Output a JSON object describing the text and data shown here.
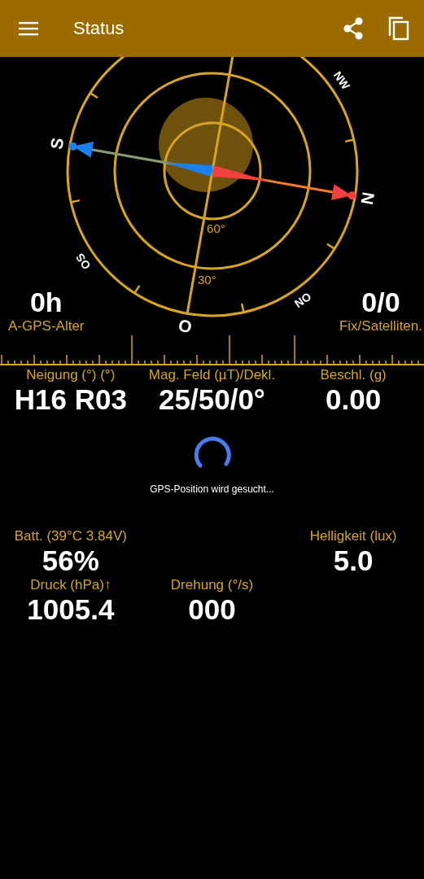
{
  "app_bar": {
    "title": "Status"
  },
  "compass": {
    "directions": [
      {
        "label": "N"
      },
      {
        "label": "NW"
      },
      {
        "label": "S"
      },
      {
        "label": "OS"
      },
      {
        "label": "O"
      },
      {
        "label": "ON"
      }
    ],
    "elevations": [
      "60°",
      "30°"
    ]
  },
  "corner_readouts": [
    {
      "value": "0h",
      "label": "A-GPS-Alter"
    },
    {
      "value": "0/0",
      "label": "Fix/Satelliten."
    }
  ],
  "sensor_row": [
    {
      "label": "Neigung (°) (°)",
      "value": "H16 R03"
    },
    {
      "label": "Mag. Feld (µT)/Dekl.",
      "value": "25/50/0°"
    },
    {
      "label": "Beschl. (g)",
      "value": "0.00"
    }
  ],
  "status": {
    "message": "GPS-Position wird gesucht..."
  },
  "sensors": [
    {
      "label": "Batt. (39°C 3.84V)",
      "value": "56%"
    },
    {
      "label": "Helligkeit (lux)",
      "value": "5.0"
    },
    {
      "label": "Druck (hPa)↑",
      "value": "1005.4"
    },
    {
      "label": "Drehung (°/s)",
      "value": "000"
    }
  ]
}
